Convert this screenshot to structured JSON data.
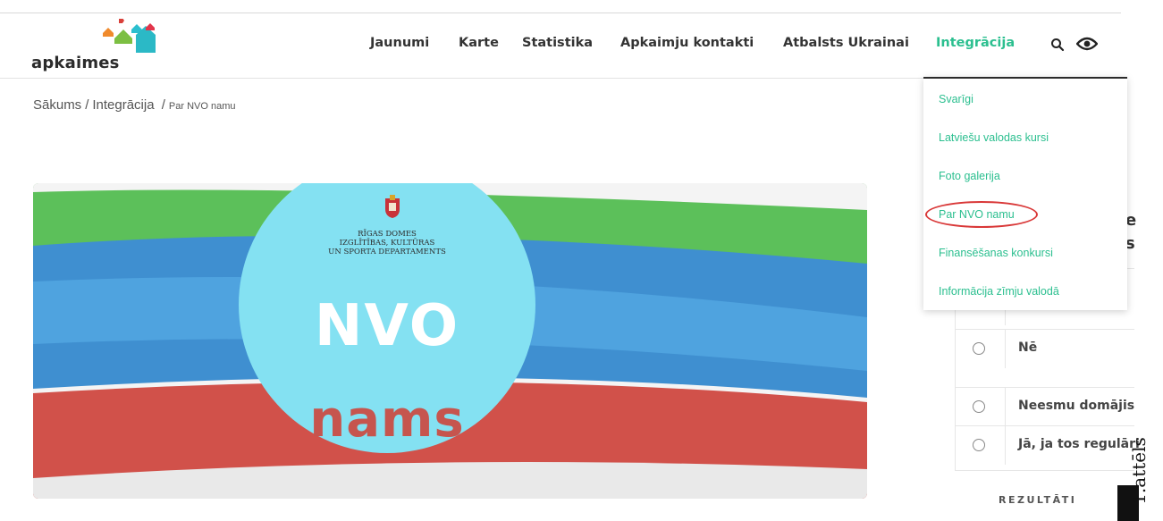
{
  "logo": {
    "text": "apkaimes"
  },
  "nav": {
    "items": [
      {
        "label": "Jaunumi"
      },
      {
        "label": "Karte"
      },
      {
        "label": "Statistika"
      },
      {
        "label": "Apkaimju kontakti"
      },
      {
        "label": "Atbalsts Ukrainai"
      },
      {
        "label": "Integrācija"
      }
    ],
    "active": "Integrācija",
    "icons": [
      "search-icon",
      "eye-icon"
    ]
  },
  "breadcrumb": {
    "home": "Sākums",
    "section": "Integrācija",
    "current": "Par NVO namu"
  },
  "hero": {
    "org_line1": "RĪGAS DOMES",
    "org_line2": "IZGLĪTĪBAS, KULTŪRAS",
    "org_line3": "UN SPORTA DEPARTAMENTS",
    "big_word1": "NVO",
    "big_word2": "nams"
  },
  "dropdown": {
    "items": [
      {
        "label": "Svarīgi"
      },
      {
        "label": "Latviešu valodas kursi"
      },
      {
        "label": "Foto galerija"
      },
      {
        "label": "Par NVO namu"
      },
      {
        "label": "Finansēšanas konkursi"
      },
      {
        "label": "Informācija zīmju valodā"
      }
    ],
    "highlighted": "Par NVO namu"
  },
  "poll": {
    "options": [
      {
        "label": "Nē"
      },
      {
        "label": "Neesmu domājis"
      },
      {
        "label": "Jā, ja tos regulāri"
      }
    ],
    "results_label": "REZULTĀTI",
    "partial_heading_1": "e",
    "partial_heading_2": "s"
  },
  "side_caption": "1.attēls",
  "colors": {
    "accent": "#2bbf8f",
    "text": "#333333",
    "highlight_oval": "#d93838",
    "circle": "#84e1f2"
  }
}
